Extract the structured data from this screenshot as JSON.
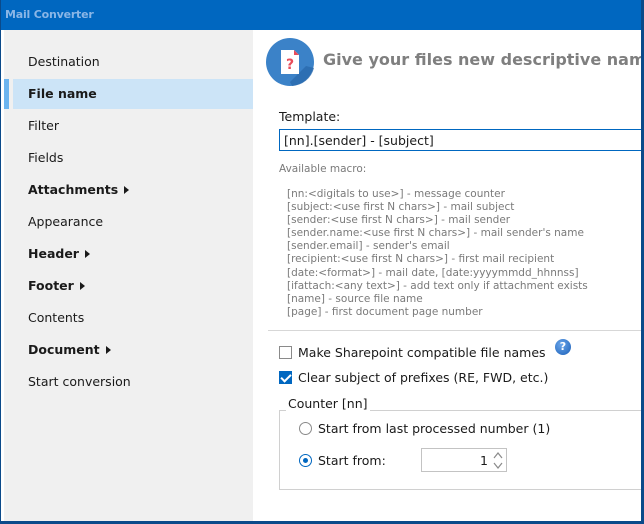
{
  "window": {
    "title": "Mail Converter"
  },
  "sidebar": {
    "items": [
      {
        "label": "Destination",
        "bold": false,
        "has_submenu": false,
        "active": false
      },
      {
        "label": "File name",
        "bold": true,
        "has_submenu": false,
        "active": true
      },
      {
        "label": "Filter",
        "bold": false,
        "has_submenu": false,
        "active": false
      },
      {
        "label": "Fields",
        "bold": false,
        "has_submenu": false,
        "active": false
      },
      {
        "label": "Attachments",
        "bold": true,
        "has_submenu": true,
        "active": false
      },
      {
        "label": "Appearance",
        "bold": false,
        "has_submenu": false,
        "active": false
      },
      {
        "label": "Header",
        "bold": true,
        "has_submenu": true,
        "active": false
      },
      {
        "label": "Footer",
        "bold": true,
        "has_submenu": true,
        "active": false
      },
      {
        "label": "Contents",
        "bold": false,
        "has_submenu": false,
        "active": false
      },
      {
        "label": "Document",
        "bold": true,
        "has_submenu": true,
        "active": false
      },
      {
        "label": "Start conversion",
        "bold": false,
        "has_submenu": false,
        "active": false
      }
    ]
  },
  "header": {
    "icon": "file-question-icon",
    "text": "Give your files new descriptive names us"
  },
  "template": {
    "label": "Template:",
    "value": "[nn].[sender] - [subject]"
  },
  "macros": {
    "label": "Available macro:",
    "items": [
      "[nn:<digitals to use>] - message counter",
      "[subject:<use first N chars>] - mail subject",
      "[sender:<use first N chars>] - mail sender",
      "[sender.name:<use first N chars>] - mail sender's name",
      "[sender.email] - sender's email",
      "[recipient:<use first N chars>] - first mail recipient",
      "[date:<format>] - mail date, [date:yyyymmdd_hhnnss]",
      "[ifattach:<any text>] - add text only if attachment exists",
      "[name] - source file name",
      "[page] - first document page number"
    ]
  },
  "options": {
    "sharepoint": {
      "label": "Make Sharepoint compatible file names",
      "checked": false
    },
    "clear_prefixes": {
      "label": "Clear subject of prefixes (RE, FWD, etc.)",
      "checked": true
    },
    "help_icon": "?"
  },
  "counter": {
    "legend": "Counter [nn]",
    "last_processed": {
      "label": "Start from last processed number (1)",
      "selected": false
    },
    "start_from": {
      "label": "Start from:",
      "selected": true,
      "value": "1"
    }
  },
  "colors": {
    "accent": "#0067c0",
    "titlebar": "#0067c0",
    "active_item": "#cce4f7",
    "active_bar": "#6cb4ef"
  }
}
